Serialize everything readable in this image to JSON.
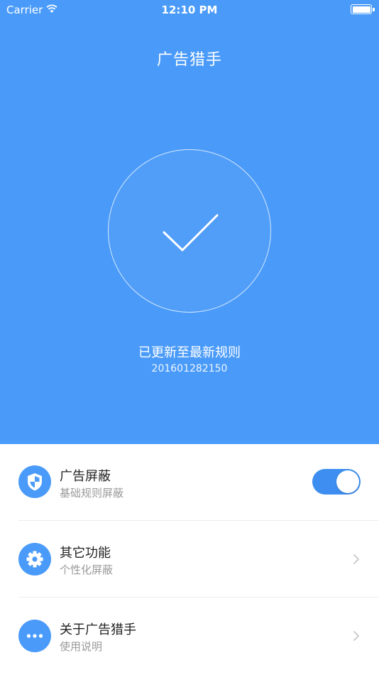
{
  "status_bar": {
    "carrier": "Carrier",
    "time": "12:10 PM"
  },
  "header": {
    "title": "广告猎手"
  },
  "status": {
    "message": "已更新至最新规则",
    "version": "201601282150",
    "icon": "checkmark-icon"
  },
  "menu": {
    "items": [
      {
        "title": "广告屏蔽",
        "subtitle": "基础规则屏蔽",
        "icon": "shield-icon",
        "control": "toggle",
        "toggle_on": true
      },
      {
        "title": "其它功能",
        "subtitle": "个性化屏蔽",
        "icon": "gear-icon",
        "control": "chevron"
      },
      {
        "title": "关于广告猎手",
        "subtitle": "使用说明",
        "icon": "more-dots-icon",
        "control": "chevron"
      }
    ]
  },
  "colors": {
    "accent": "#4a9bf9",
    "toggle_on": "#3d8ef0"
  }
}
